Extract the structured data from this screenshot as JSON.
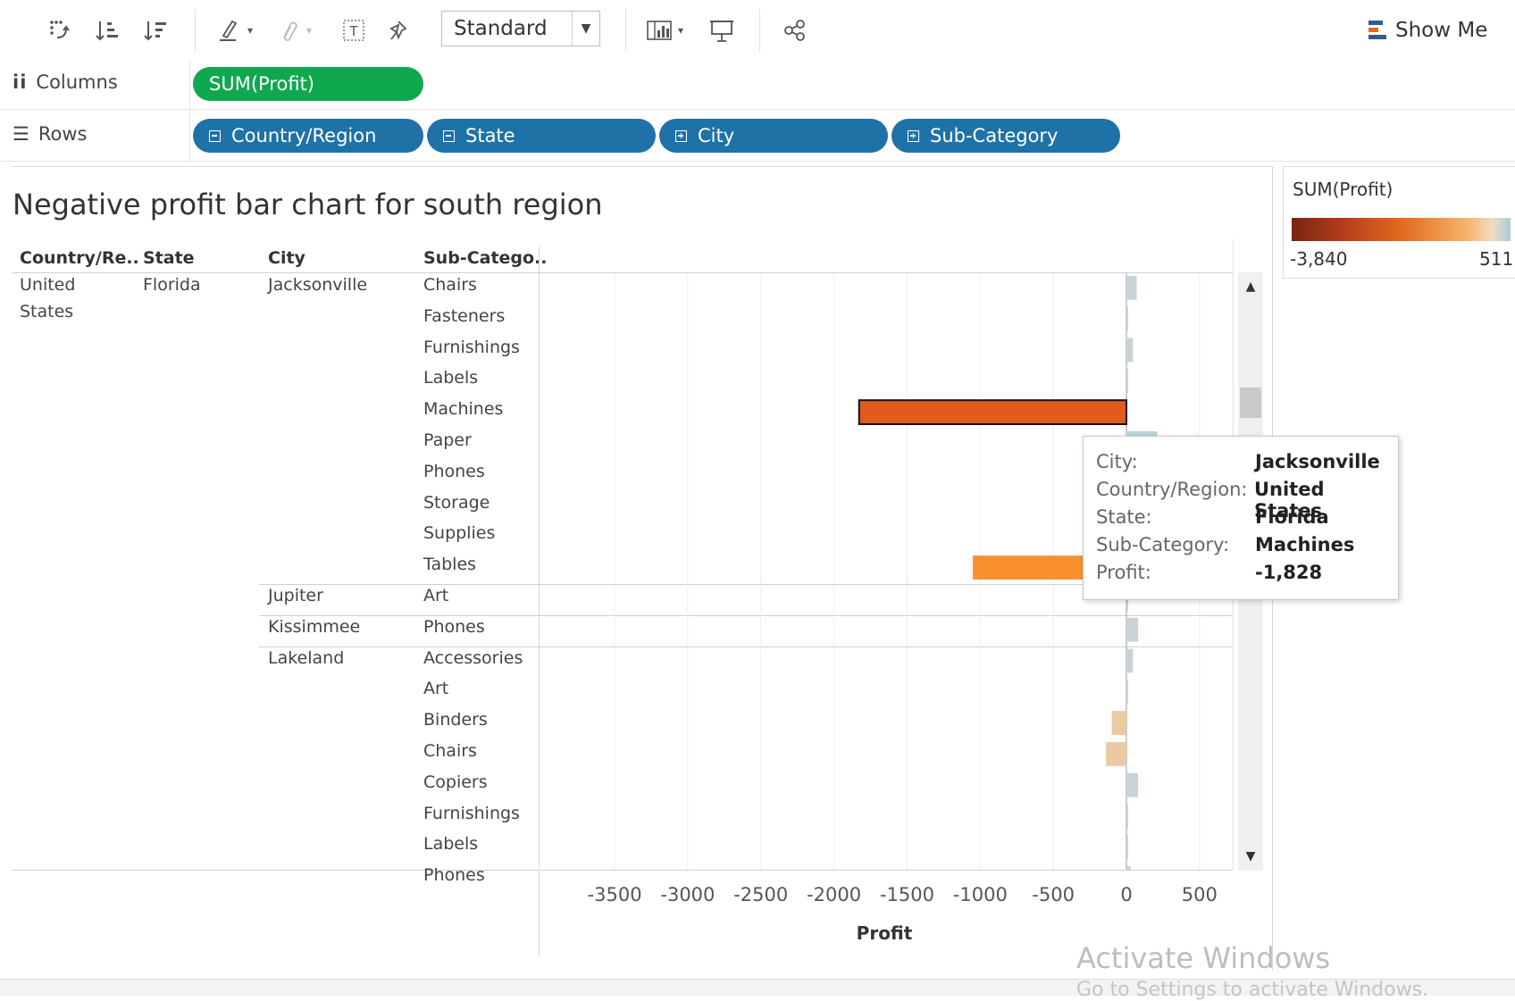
{
  "toolbar": {
    "fit_value": "Standard",
    "show_me_label": "Show Me",
    "icons": [
      "swap-rows-columns-icon",
      "sort-ascending-icon",
      "sort-descending-icon",
      "highlight-icon",
      "group-icon",
      "label-icon",
      "pin-icon",
      "show-labels-icon",
      "presentation-icon",
      "share-icon"
    ]
  },
  "shelves": {
    "columns_label": "Columns",
    "columns_pills": [
      "SUM(Profit)"
    ],
    "rows_label": "Rows",
    "rows_pills": [
      "Country/Region",
      "State",
      "City",
      "Sub-Category"
    ]
  },
  "view": {
    "title": "Negative profit bar chart for south region",
    "headers": [
      "Country/Re..",
      "State",
      "City",
      "Sub-Catego.."
    ],
    "country": [
      "United",
      "States"
    ],
    "state": "Florida",
    "cities": [
      "Jacksonville",
      "Jupiter",
      "Kissimmee",
      "Lakeland"
    ]
  },
  "chart_data": {
    "type": "bar",
    "orientation": "horizontal",
    "xlabel": "Profit",
    "xlim": [
      -3840,
      511
    ],
    "ticks": [
      -3500,
      -3000,
      -2500,
      -2000,
      -1500,
      -1000,
      -500,
      0,
      500
    ],
    "rows": [
      {
        "city": "Jacksonville",
        "subcategory": "Chairs",
        "value": 70
      },
      {
        "city": "Jacksonville",
        "subcategory": "Fasteners",
        "value": 3
      },
      {
        "city": "Jacksonville",
        "subcategory": "Furnishings",
        "value": 45
      },
      {
        "city": "Jacksonville",
        "subcategory": "Labels",
        "value": 5
      },
      {
        "city": "Jacksonville",
        "subcategory": "Machines",
        "value": -1828
      },
      {
        "city": "Jacksonville",
        "subcategory": "Paper",
        "value": 210
      },
      {
        "city": "Jacksonville",
        "subcategory": "Phones",
        "value": 0
      },
      {
        "city": "Jacksonville",
        "subcategory": "Storage",
        "value": 0
      },
      {
        "city": "Jacksonville",
        "subcategory": "Supplies",
        "value": 0
      },
      {
        "city": "Jacksonville",
        "subcategory": "Tables",
        "value": -1050
      },
      {
        "city": "Jupiter",
        "subcategory": "Art",
        "value": 0
      },
      {
        "city": "Kissimmee",
        "subcategory": "Phones",
        "value": 80
      },
      {
        "city": "Lakeland",
        "subcategory": "Accessories",
        "value": 45
      },
      {
        "city": "Lakeland",
        "subcategory": "Art",
        "value": 8
      },
      {
        "city": "Lakeland",
        "subcategory": "Binders",
        "value": -100
      },
      {
        "city": "Lakeland",
        "subcategory": "Chairs",
        "value": -140
      },
      {
        "city": "Lakeland",
        "subcategory": "Copiers",
        "value": 80
      },
      {
        "city": "Lakeland",
        "subcategory": "Furnishings",
        "value": 10
      },
      {
        "city": "Lakeland",
        "subcategory": "Labels",
        "value": 5
      },
      {
        "city": "Lakeland",
        "subcategory": "Phones",
        "value": 30
      }
    ]
  },
  "legend": {
    "title": "SUM(Profit)",
    "min_label": "-3,840",
    "max_label": "511"
  },
  "tooltip": {
    "rows": [
      {
        "key": "City:",
        "value": "Jacksonville"
      },
      {
        "key": "Country/Region:",
        "value": "United States"
      },
      {
        "key": "State:",
        "value": "Florida"
      },
      {
        "key": "Sub-Category:",
        "value": "Machines"
      },
      {
        "key": "Profit:",
        "value": "-1,828"
      }
    ]
  },
  "watermark": {
    "line1": "Activate Windows",
    "line2": "Go to Settings to activate Windows."
  },
  "colors": {
    "selected_bar": "#e35b1c",
    "neg_strong": "#f7912e",
    "neg_light": "#ecc9a3",
    "pos_light": "#b9d3dc",
    "near_zero": "#c9d3d6"
  }
}
